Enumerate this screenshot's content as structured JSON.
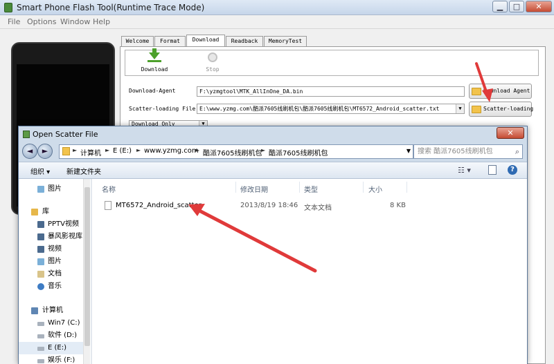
{
  "main_window": {
    "title": "Smart Phone Flash Tool(Runtime Trace Mode)",
    "minimize": "▁",
    "maximize": "□",
    "close": "✕",
    "menu": [
      "File",
      "Options",
      "Window",
      "Help"
    ]
  },
  "tabs": [
    "Welcome",
    "Format",
    "Download",
    "Readback",
    "MemoryTest"
  ],
  "active_tab": "Download",
  "toolbar": {
    "download_label": "Download",
    "stop_label": "Stop"
  },
  "download_agent": {
    "label": "Download-Agent",
    "value": "F:\\yzmgtool\\MTK_AllInOne_DA.bin",
    "button": "Download Agent"
  },
  "scatter": {
    "label": "Scatter-loading File",
    "value": "E:\\www.yzmg.com\\酷派7605线刷机包\\酷派7605线刷机包\\MT6572_Android_scatter.txt",
    "button": "Scatter-loading"
  },
  "mode_select": {
    "value": "Download Only"
  },
  "dialog": {
    "title": "Open Scatter File",
    "close": "✕",
    "back": "◄",
    "forward": "►",
    "address": [
      "计算机",
      "E (E:)",
      "www.yzmg.com",
      "酷派7605线刷机包",
      "酷派7605线刷机包"
    ],
    "search_placeholder": "搜索 酷派7605线刷机包",
    "commands": {
      "organize": "组织 ▾",
      "new_folder": "新建文件夹"
    },
    "nav_pane": [
      {
        "label": "图片",
        "icon": "pictures-icon"
      },
      {
        "label": "库",
        "icon": "library-icon"
      },
      {
        "label": "PPTV视频",
        "icon": "video-library-icon"
      },
      {
        "label": "暴风影视库",
        "icon": "video-library-icon"
      },
      {
        "label": "视频",
        "icon": "video-library-icon"
      },
      {
        "label": "图片",
        "icon": "pictures-icon"
      },
      {
        "label": "文档",
        "icon": "documents-icon"
      },
      {
        "label": "音乐",
        "icon": "music-icon"
      },
      {
        "label": "计算机",
        "icon": "computer-icon"
      },
      {
        "label": "Win7 (C:)",
        "icon": "drive-icon"
      },
      {
        "label": "软件 (D:)",
        "icon": "drive-icon"
      },
      {
        "label": "E (E:)",
        "icon": "drive-icon"
      },
      {
        "label": "娱乐 (F:)",
        "icon": "drive-icon"
      }
    ],
    "columns": [
      "名称",
      "修改日期",
      "类型",
      "大小"
    ],
    "files": [
      {
        "name": "MT6572_Android_scatter",
        "modified": "2013/8/19 18:46",
        "type": "文本文档",
        "size": "8 KB"
      }
    ]
  },
  "colors": {
    "annotation_arrow": "#e03a3a",
    "folder": "#f2c34c",
    "download_arrow": "#4ca02b"
  }
}
